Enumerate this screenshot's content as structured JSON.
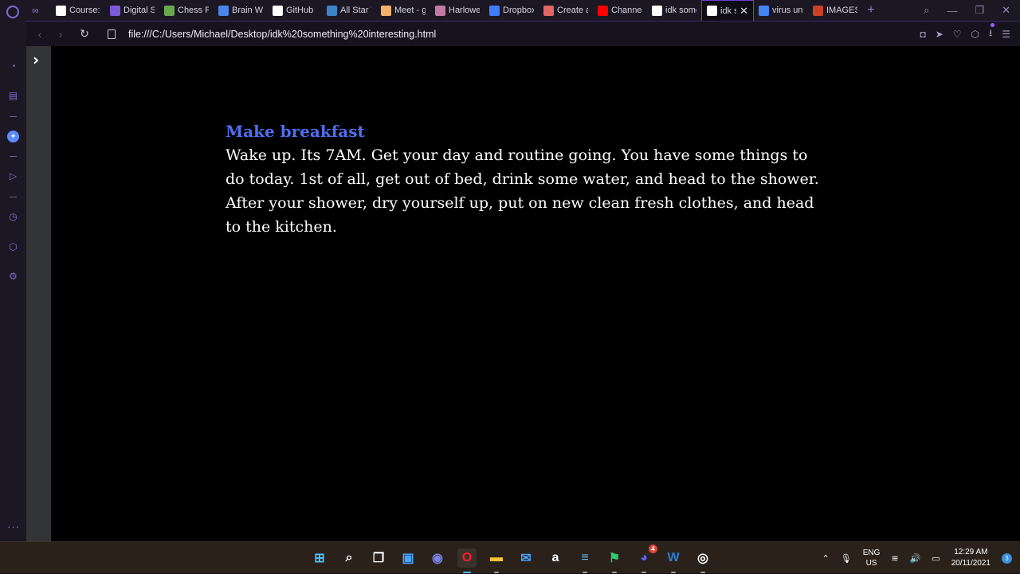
{
  "browser": {
    "tabs": [
      {
        "label": "Course: (",
        "icon": "document-icon",
        "color": "#ffffff"
      },
      {
        "label": "Digital St",
        "icon": "list-icon",
        "color": "#7b5cd6"
      },
      {
        "label": "Chess Pu",
        "icon": "chess-pawn-icon",
        "color": "#6aa84f"
      },
      {
        "label": "Brain Wr",
        "icon": "docs-icon",
        "color": "#4a86e8"
      },
      {
        "label": "GitHub",
        "icon": "github-icon",
        "color": "#ffffff"
      },
      {
        "label": "All Star T",
        "icon": "allstar-icon",
        "color": "#3d85c6"
      },
      {
        "label": "Meet - g",
        "icon": "meet-icon",
        "color": "#f6b26b"
      },
      {
        "label": "Harlowe",
        "icon": "harlowe-icon",
        "color": "#c27ba0"
      },
      {
        "label": "Dropbox",
        "icon": "dropbox-icon",
        "color": "#3d7eff"
      },
      {
        "label": "Create a",
        "icon": "create-icon",
        "color": "#e06666"
      },
      {
        "label": "Channel",
        "icon": "youtube-icon",
        "color": "#ff0000"
      },
      {
        "label": "idk some",
        "icon": "globe-icon",
        "color": "#ffffff"
      }
    ],
    "active_tab": {
      "label": "idk so",
      "icon": "globe-icon"
    },
    "after_tabs": [
      {
        "label": "virus und",
        "icon": "google-icon",
        "color": "#4285f4"
      },
      {
        "label": "IMAGES:",
        "icon": "images-icon",
        "color": "#cc4125"
      }
    ],
    "url": "file:///C:/Users/Michael/Desktop/idk%20something%20interesting.html",
    "close_glyph": "✕",
    "new_tab_glyph": "+"
  },
  "page": {
    "heading": "Make breakfast",
    "paragraph": "Wake up. Its 7AM. Get your day and routine going. You have some things to do today. 1st of all, get out of bed, drink some water, and head to the shower. After your shower, dry yourself up, put on new clean fresh clothes, and head to the kitchen.",
    "heading_color": "#4f6ff0",
    "text_color": "#ffffff",
    "background_color": "#000000"
  },
  "taskbar": {
    "apps": [
      {
        "name": "start-button-icon",
        "glyph": "⊞",
        "color": "#4cc2ff"
      },
      {
        "name": "search-icon",
        "glyph": "⌕",
        "color": "#ffffff"
      },
      {
        "name": "task-view-icon",
        "glyph": "❐",
        "color": "#ffffff"
      },
      {
        "name": "widgets-icon",
        "glyph": "▣",
        "color": "#4aa3ff"
      },
      {
        "name": "chat-icon",
        "glyph": "◉",
        "color": "#7b83eb"
      },
      {
        "name": "opera-icon",
        "glyph": "O",
        "color": "#ff1b2d"
      },
      {
        "name": "file-explorer-icon",
        "glyph": "▬",
        "color": "#f8c537"
      },
      {
        "name": "mail-icon",
        "glyph": "✉",
        "color": "#4aa3ff"
      },
      {
        "name": "amazon-icon",
        "glyph": "a",
        "color": "#ffffff"
      },
      {
        "name": "notepad-icon",
        "glyph": "≡",
        "color": "#5cc2f2"
      },
      {
        "name": "flag-app-icon",
        "glyph": "⚑",
        "color": "#2ecc71"
      },
      {
        "name": "discord-icon",
        "glyph": "◕",
        "color": "#5865f2",
        "badge": "4"
      },
      {
        "name": "word-icon",
        "glyph": "W",
        "color": "#2b7cd3"
      },
      {
        "name": "obs-icon",
        "glyph": "◎",
        "color": "#ffffff"
      }
    ],
    "language_line1": "ENG",
    "language_line2": "US",
    "time": "12:29 AM",
    "date": "20/11/2021",
    "notifications": "3"
  }
}
